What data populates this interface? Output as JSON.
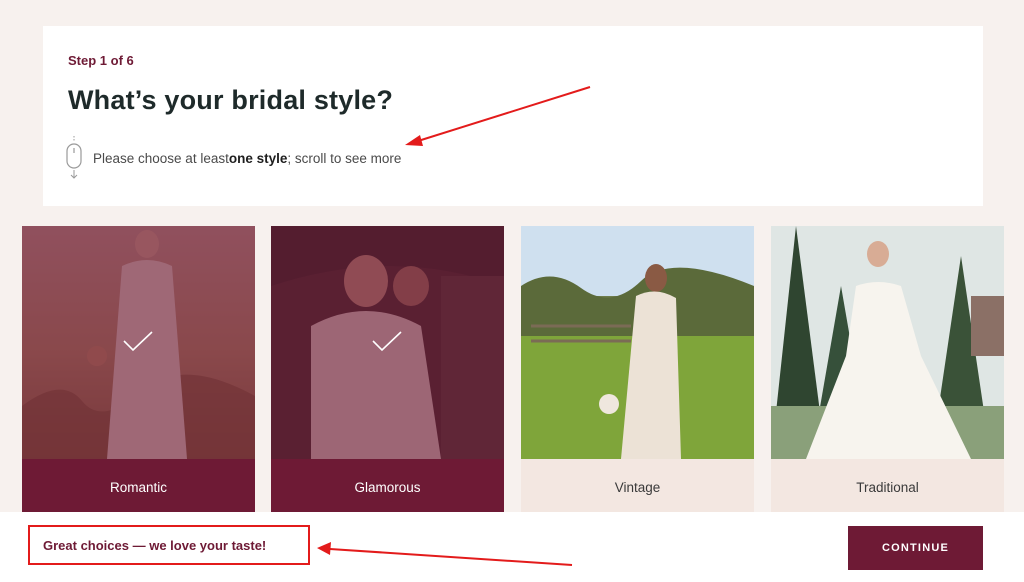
{
  "header": {
    "step": "Step 1 of 6",
    "title": "What’s your bridal style?",
    "hint_prefix": "Please choose at least ",
    "hint_bold": "one style",
    "hint_suffix": "; scroll to see more",
    "hint_icon": "mouse-scroll-icon"
  },
  "styles": [
    {
      "label": "Romantic",
      "selected": true
    },
    {
      "label": "Glamorous",
      "selected": true
    },
    {
      "label": "Vintage",
      "selected": false
    },
    {
      "label": "Traditional",
      "selected": false
    }
  ],
  "footer": {
    "feedback": "Great choices — we love your taste!",
    "continue_label": "CONTINUE"
  },
  "colors": {
    "brand": "#6e1a35",
    "background": "#f7f1ee",
    "unselected_label_bg": "#f3e7e1",
    "annotation": "#e31b1b"
  }
}
